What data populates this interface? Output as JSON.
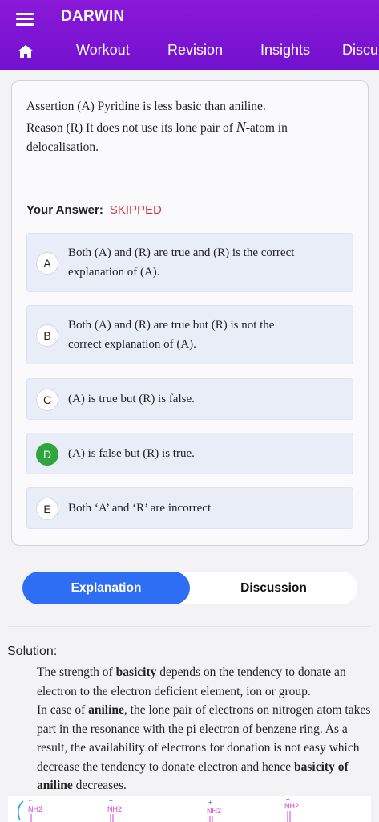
{
  "app": {
    "title": "DARWIN"
  },
  "nav": {
    "home_icon": "home-icon",
    "menu_icon": "hamburger-menu-icon",
    "tabs": [
      {
        "label": "Workout"
      },
      {
        "label": "Revision"
      },
      {
        "label": "Insights"
      },
      {
        "label": "Discu"
      }
    ]
  },
  "question": {
    "line1": "Assertion (A) Pyridine is less basic than aniline.",
    "line2_prefix": "Reason (R) It does not use its lone pair of ",
    "line2_symbol": "N",
    "line2_suffix": "-atom in",
    "line3": "delocalisation."
  },
  "answer": {
    "label": "Your Answer:",
    "value": "SKIPPED"
  },
  "options": [
    {
      "letter": "A",
      "line1": "Both (A) and (R) are true and (R) is the correct",
      "line2": "explanation of (A).",
      "correct": false
    },
    {
      "letter": "B",
      "line1": "Both (A) and (R) are true but (R) is not the",
      "line2": "correct explanation of (A).",
      "correct": false
    },
    {
      "letter": "C",
      "line1": "(A) is true but (R) is false.",
      "correct": false
    },
    {
      "letter": "D",
      "line1": "(A) is false but (R) is true.",
      "correct": true
    },
    {
      "letter": "E",
      "line1": "Both ‘A’ and ‘R’ are incorrect",
      "correct": false
    }
  ],
  "toggle": {
    "explanation": "Explanation",
    "discussion": "Discussion",
    "active": "Explanation"
  },
  "solution": {
    "heading": "Solution:",
    "p1_a": "The strength of ",
    "p1_b": "basicity",
    "p1_c": " depends on the tendency to donate an electron to the electron deficient element, ion or group.",
    "p2_a": "In case of ",
    "p2_b": "aniline",
    "p2_c": ", the lone pair of electrons on nitrogen atom takes part in the resonance with the pi electron of benzene ring. As a result, the availability of electrons for donation is not easy which decrease the tendency to donate electron and hence ",
    "p2_d": "basicity of aniline",
    "p2_e": " decreases."
  },
  "structures": {
    "labels": [
      "NH2",
      "NH2",
      "NH2",
      "NH2"
    ],
    "color": "#d63bd6"
  },
  "colors": {
    "header": "#7a14d4",
    "accent_blue": "#2d6ef5",
    "skipped_red": "#d43a3a",
    "correct_green": "#2ea53d",
    "option_bg": "#e9edf8"
  }
}
